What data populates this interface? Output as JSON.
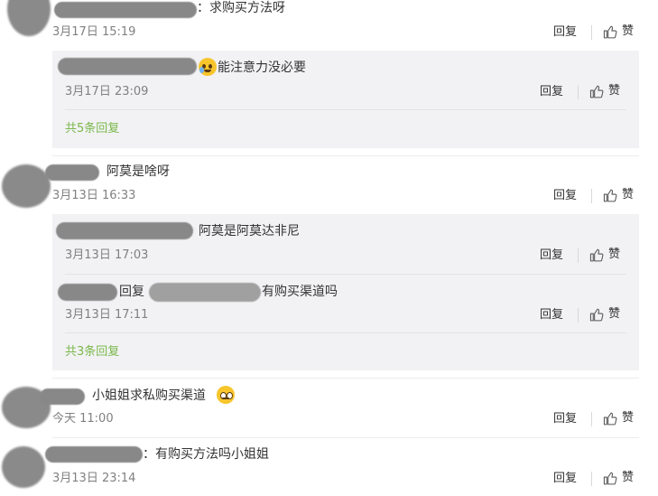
{
  "comments": [
    {
      "text": "：求购买方法呀",
      "time": "3月17日 15:19",
      "reply_label": "回复",
      "like_label": "赞",
      "replies": [
        {
          "text": "能注意力没必要",
          "time": "3月17日 23:09",
          "reply_label": "回复",
          "like_label": "赞"
        }
      ],
      "total_replies": "共5条回复"
    },
    {
      "text": "阿莫是啥呀",
      "time": "3月13日 16:33",
      "reply_label": "回复",
      "like_label": "赞",
      "replies": [
        {
          "text": "阿莫是阿莫达非尼",
          "time": "3月13日 17:03",
          "reply_label": "回复",
          "like_label": "赞"
        },
        {
          "prefix": "回复",
          "text": "有购买渠道吗",
          "time": "3月13日 17:11",
          "reply_label": "回复",
          "like_label": "赞"
        }
      ],
      "total_replies": "共3条回复"
    },
    {
      "text": "小姐姐求私购买渠道",
      "time": "今天 11:00",
      "reply_label": "回复",
      "like_label": "赞"
    },
    {
      "text": "：有购买方法吗小姐姐",
      "time": "3月13日 23:14",
      "reply_label": "回复",
      "like_label": "赞"
    }
  ],
  "icons": {
    "like": "thumbs-up-icon",
    "emoji_crying": "crying-laughing-emoji-icon",
    "emoji_pleading": "pleading-face-emoji-icon"
  },
  "colors": {
    "total_replies": "#7bb84a",
    "subreply_bg": "#f2f2f5",
    "time": "#808080"
  }
}
